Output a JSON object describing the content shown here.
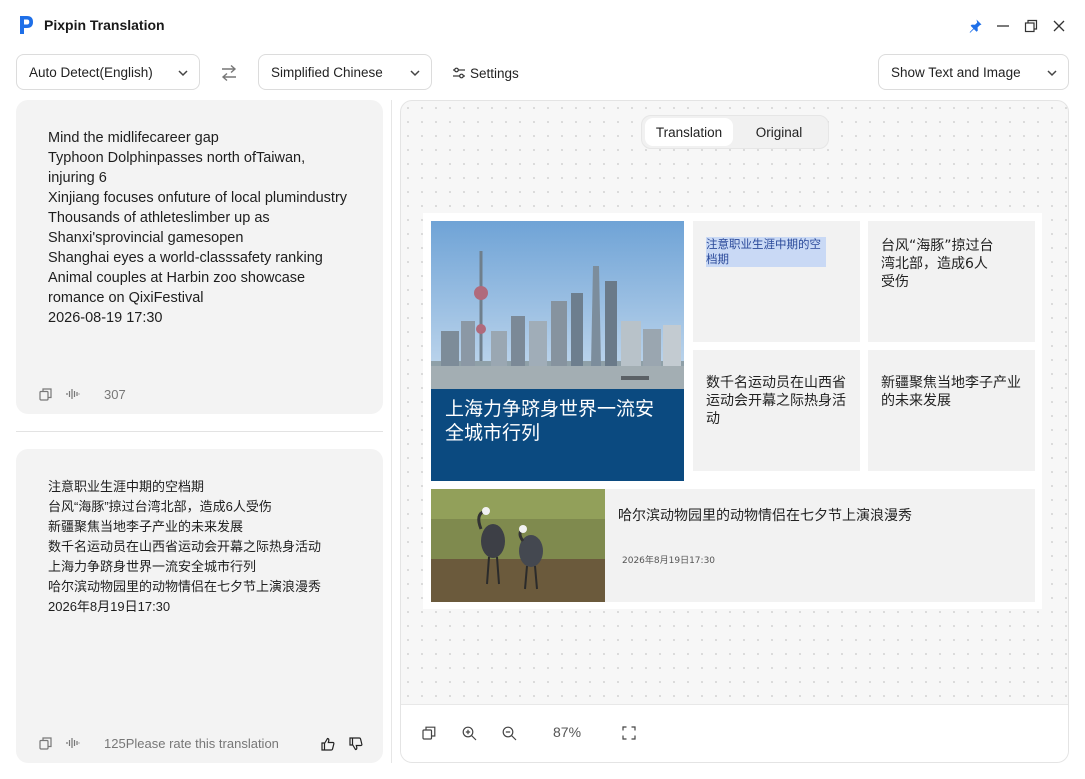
{
  "app": {
    "title": "Pixpin Translation"
  },
  "toolbar": {
    "source_lang": "Auto Detect(English)",
    "target_lang": "Simplified Chinese",
    "settings_label": "Settings",
    "display_mode": "Show Text and Image"
  },
  "source_panel": {
    "lines": [
      "Mind the midlifecareer gap",
      "Typhoon Dolphinpasses north ofTaiwan, injuring 6",
      "Xinjiang focuses onfuture of local plumindustry",
      "Thousands of athleteslimber up as Shanxi'sprovincial gamesopen",
      "Shanghai eyes a world-classsafety ranking",
      "Animal couples at Harbin zoo showcase romance on QixiFestival",
      "2026-08-19 17:30"
    ],
    "char_count": "307"
  },
  "target_panel": {
    "lines": [
      "注意职业生涯中期的空档期",
      "台风“海豚”掠过台湾北部，造成6人受伤",
      "新疆聚焦当地李子产业的未来发展",
      "数千名运动员在山西省运动会开幕之际热身活动",
      "上海力争跻身世界一流安全城市行列",
      "哈尔滨动物园里的动物情侣在七夕节上演浪漫秀",
      "2026年8月19日17:30"
    ],
    "char_count": "125",
    "rate_prompt": "Please rate this translation"
  },
  "preview": {
    "tabs": {
      "translation": "Translation",
      "original": "Original"
    },
    "active_tab": "translation",
    "zoom": "87%",
    "image": {
      "hero_caption": "上海力争跻身世界一流安全城市行列",
      "tile1": "注意职业生涯中期的空档期",
      "tile2": "台风“海豚”掠过台湾北部，造成6人受伤",
      "tile3": "数千名运动员在山西省运动会开幕之际热身活动",
      "tile4": "新疆聚焦当地李子产业的未来发展",
      "news_title": "哈尔滨动物园里的动物情侣在七夕节上演浪漫秀",
      "news_date": "2026年8月19日17:30"
    }
  },
  "colors": {
    "accent": "#1e6fe8",
    "hero_band": "#0b4a80",
    "highlight": "#c9d9f5"
  }
}
